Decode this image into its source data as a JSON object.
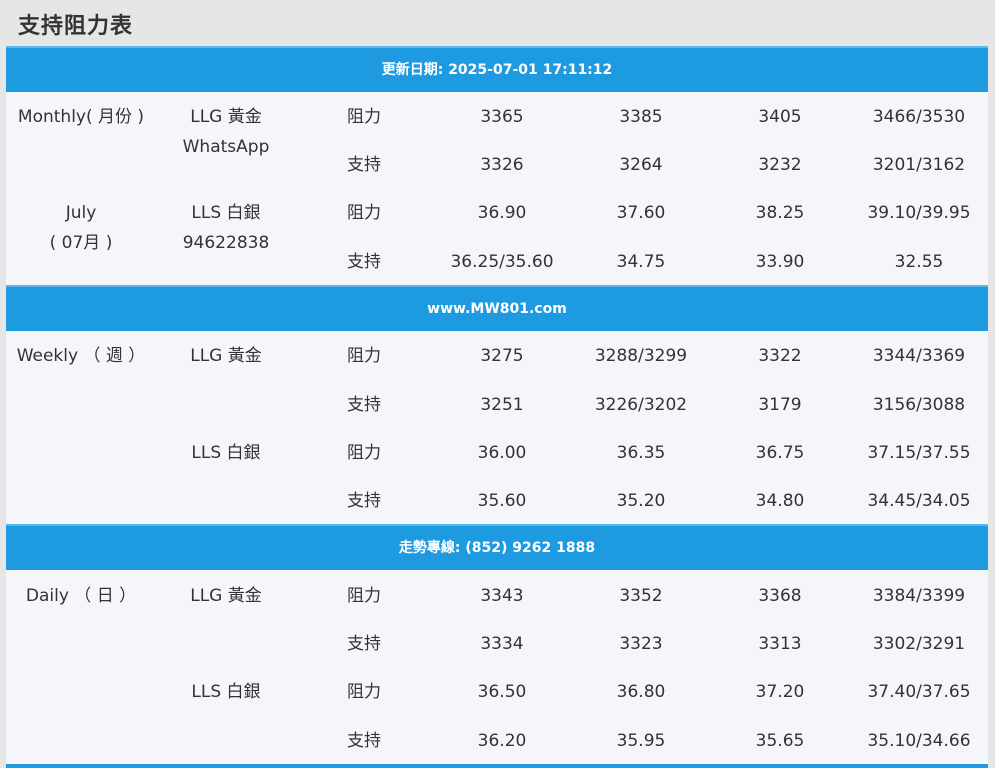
{
  "page": {
    "title": "支持阻力表"
  },
  "colors": {
    "band": "#1e9be0",
    "background": "#f5f6f9",
    "text": "#333333"
  },
  "bands": {
    "update": "更新日期: 2025-07-01 17:11:12",
    "website": "www.MW801.com",
    "hotline": "走勢專線: (852) 9262 1888"
  },
  "monthly": {
    "period_line1": "Monthly( 月份 )",
    "month_line1": "July",
    "month_line2": "( 07月 )",
    "llg_label": "LLG 黃金",
    "contact_label": "WhatsApp",
    "lls_label": "LLS 白銀",
    "contact_number": "94622838",
    "rows": [
      {
        "type": "阻力",
        "v1": "3365",
        "v2": "3385",
        "v3": "3405",
        "v4": "3466/3530"
      },
      {
        "type": "支持",
        "v1": "3326",
        "v2": "3264",
        "v3": "3232",
        "v4": "3201/3162"
      },
      {
        "type": "阻力",
        "v1": "36.90",
        "v2": "37.60",
        "v3": "38.25",
        "v4": "39.10/39.95"
      },
      {
        "type": "支持",
        "v1": "36.25/35.60",
        "v2": "34.75",
        "v3": "33.90",
        "v4": "32.55"
      }
    ]
  },
  "weekly": {
    "period_line1": "Weekly （ 週 ）",
    "llg_label": "LLG 黃金",
    "lls_label": "LLS 白銀",
    "rows": [
      {
        "type": "阻力",
        "v1": "3275",
        "v2": "3288/3299",
        "v3": "3322",
        "v4": "3344/3369"
      },
      {
        "type": "支持",
        "v1": "3251",
        "v2": "3226/3202",
        "v3": "3179",
        "v4": "3156/3088"
      },
      {
        "type": "阻力",
        "v1": "36.00",
        "v2": "36.35",
        "v3": "36.75",
        "v4": "37.15/37.55"
      },
      {
        "type": "支持",
        "v1": "35.60",
        "v2": "35.20",
        "v3": "34.80",
        "v4": "34.45/34.05"
      }
    ]
  },
  "daily": {
    "period_line1": "Daily （ 日 ）",
    "llg_label": "LLG 黃金",
    "lls_label": "LLS 白銀",
    "rows": [
      {
        "type": "阻力",
        "v1": "3343",
        "v2": "3352",
        "v3": "3368",
        "v4": "3384/3399"
      },
      {
        "type": "支持",
        "v1": "3334",
        "v2": "3323",
        "v3": "3313",
        "v4": "3302/3291"
      },
      {
        "type": "阻力",
        "v1": "36.50",
        "v2": "36.80",
        "v3": "37.20",
        "v4": "37.40/37.65"
      },
      {
        "type": "支持",
        "v1": "36.20",
        "v2": "35.95",
        "v3": "35.65",
        "v4": "35.10/34.66"
      }
    ]
  }
}
